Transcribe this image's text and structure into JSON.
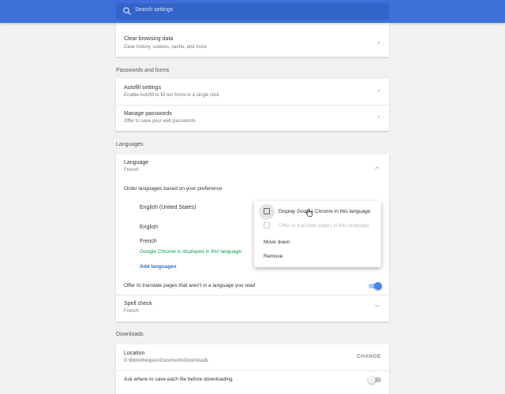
{
  "search": {
    "placeholder": "Search settings",
    "icon": "search-icon"
  },
  "privacy": {
    "clear_data": {
      "title": "Clear browsing data",
      "subtitle": "Clear history, cookies, cache, and more"
    }
  },
  "passwords_forms": {
    "section_title": "Passwords and forms",
    "autofill": {
      "title": "Autofill settings",
      "subtitle": "Enable Autofill to fill out forms in a single click"
    },
    "passwords": {
      "title": "Manage passwords",
      "subtitle": "Offer to save your web passwords"
    }
  },
  "languages": {
    "section_title": "Languages",
    "language": {
      "title": "Language",
      "value": "French"
    },
    "order_label": "Order languages based on your preference",
    "items": [
      "English (United States)",
      "English",
      "French"
    ],
    "french_note": "Google Chrome is displayed in this language",
    "add_languages": "Add languages",
    "offer_translate": {
      "label": "Offer to translate pages that aren't in a language you read",
      "enabled": true
    },
    "spell_check": {
      "title": "Spell check",
      "value": "French"
    }
  },
  "context_menu": {
    "display_in_language": "Display Google Chrome in this language",
    "offer_translate": "Offer to translate pages in this language",
    "move_down": "Move down",
    "remove": "Remove"
  },
  "downloads": {
    "section_title": "Downloads",
    "location": {
      "title": "Location",
      "path": "D:\\Bibliothèques\\Documents\\Downloads",
      "button": "CHANGE"
    },
    "ask_where": {
      "label": "Ask where to save each file before downloading",
      "enabled": false
    }
  },
  "colors": {
    "accent": "#3f6fd8",
    "toggle_on": "#4285f4",
    "green": "#0f9d58",
    "link": "#3367d6"
  }
}
